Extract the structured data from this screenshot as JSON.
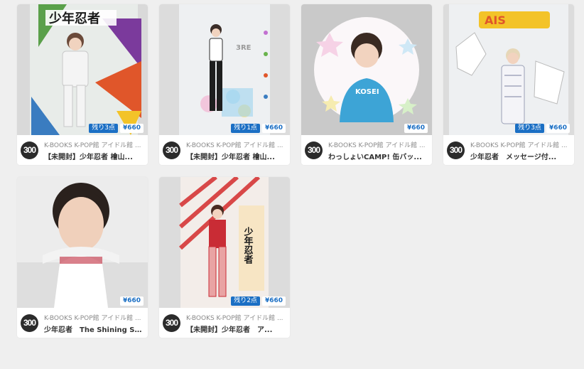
{
  "accent_color": "#1b6fc4",
  "items": [
    {
      "shop_icon_text": "300",
      "shop_name": "K-BOOKS K-POP館 アイドル館 ...",
      "title": "【未開封】少年忍者 檜山...",
      "stock": "残り3点",
      "price": "¥660",
      "image_text": "少年忍者"
    },
    {
      "shop_icon_text": "300",
      "shop_name": "K-BOOKS K-POP館 アイドル館 ...",
      "title": "【未開封】少年忍者 檜山...",
      "stock": "残り1点",
      "price": "¥660",
      "image_text": "3RE"
    },
    {
      "shop_icon_text": "300",
      "shop_name": "K-BOOKS K-POP館 アイドル館 ...",
      "title": "わっしょいCAMP! 缶バッ...",
      "stock": "",
      "price": "¥660",
      "image_text": "KOSEI"
    },
    {
      "shop_icon_text": "300",
      "shop_name": "K-BOOKS K-POP館 アイドル館 ...",
      "title": "少年忍者　メッセージ付...",
      "stock": "残り3点",
      "price": "¥660",
      "image_text": "AIS"
    },
    {
      "shop_icon_text": "300",
      "shop_name": "K-BOOKS K-POP館 アイドル館 ...",
      "title": "少年忍者　The Shining St...",
      "stock": "",
      "price": "¥660",
      "image_text": ""
    },
    {
      "shop_icon_text": "300",
      "shop_name": "K-BOOKS K-POP館 アイドル館 ...",
      "title": "【未開封】少年忍者　ア...",
      "stock": "残り2点",
      "price": "¥660",
      "image_text": "少年忍者"
    }
  ]
}
